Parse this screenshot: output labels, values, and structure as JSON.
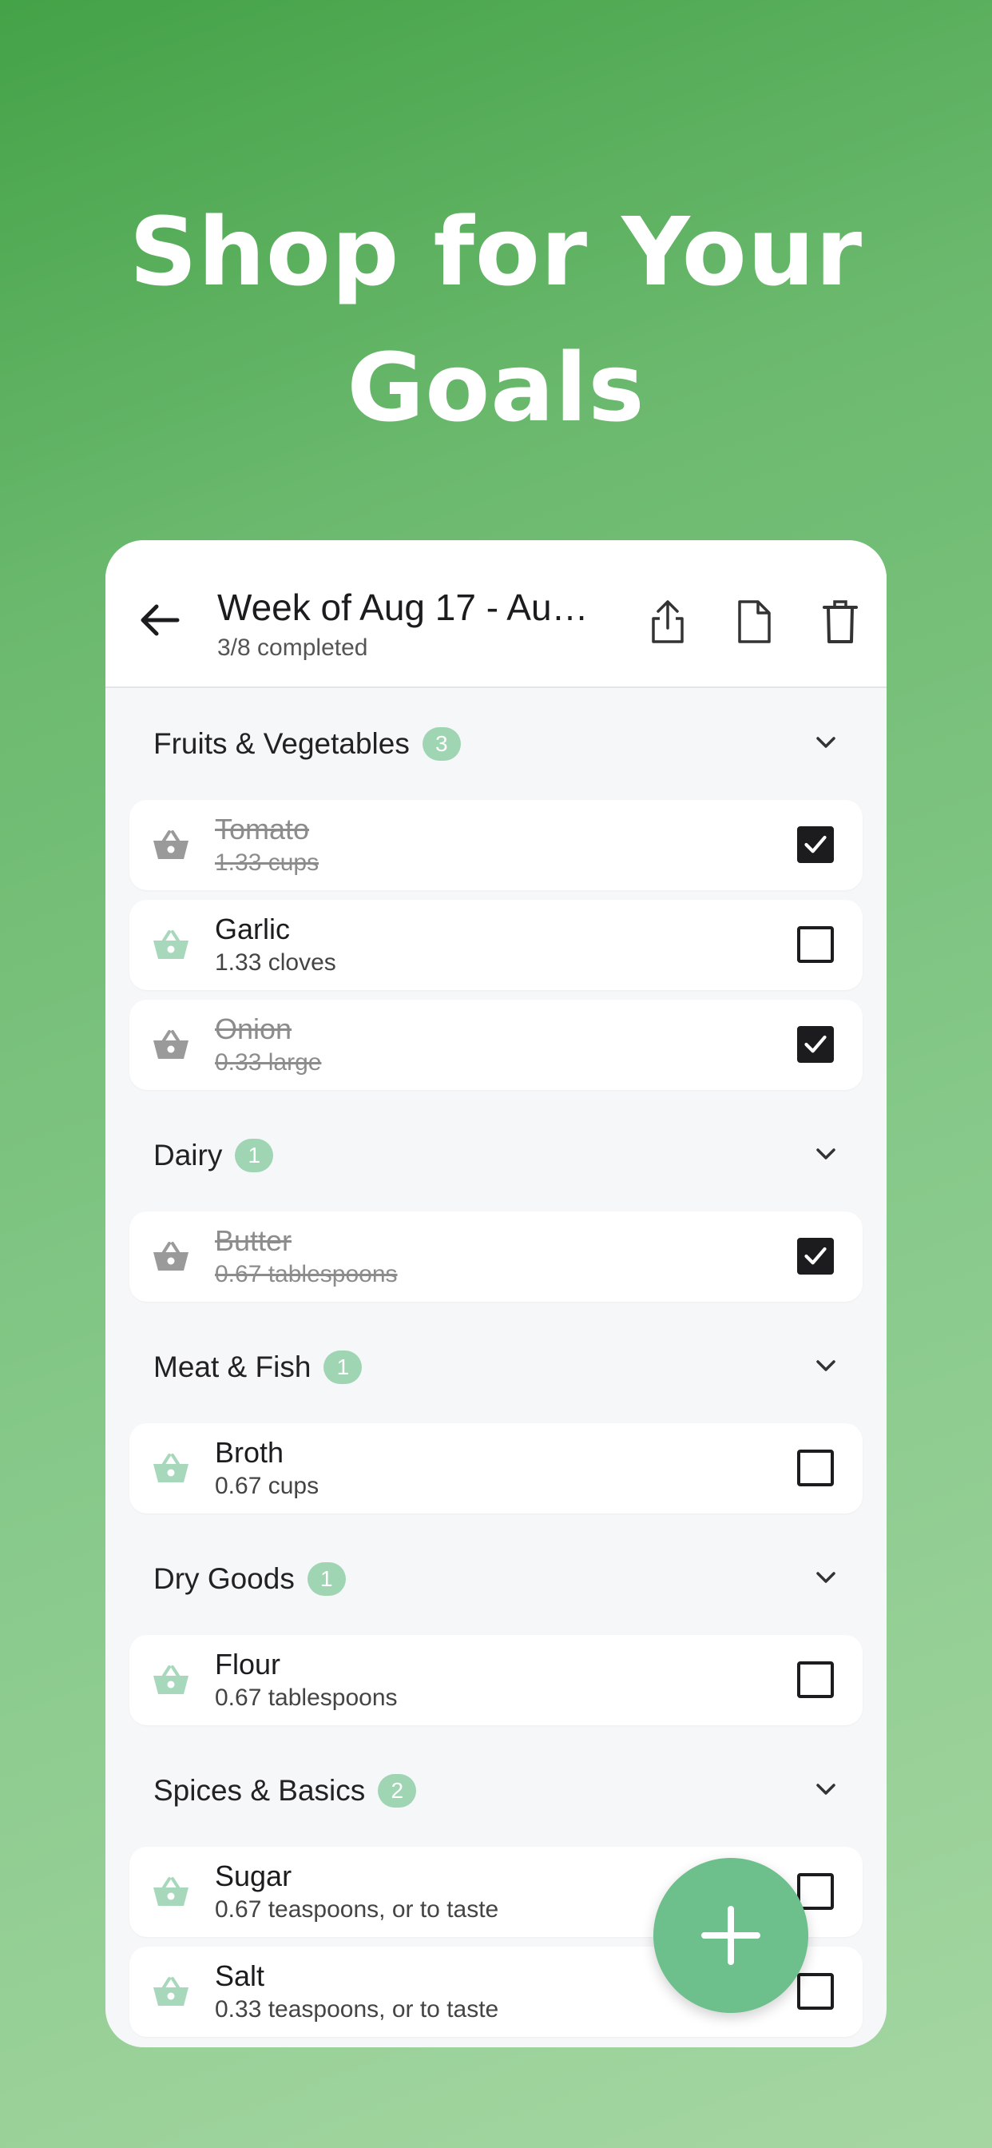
{
  "hero": {
    "line1": "Shop for Your",
    "line2": "Goals"
  },
  "appbar": {
    "title": "Week of Aug 17 - Aug…",
    "subtitle": "3/8 completed",
    "icons": [
      "back-arrow-icon",
      "share-icon",
      "document-icon",
      "trash-icon"
    ]
  },
  "colors": {
    "accent": "#6dbf8c",
    "badge": "#9fd5b2",
    "basket_active": "#a8d8bb",
    "basket_done": "#9a9a9a"
  },
  "sections": [
    {
      "title": "Fruits & Vegetables",
      "count": "3",
      "items": [
        {
          "name": "Tomato",
          "qty": "1.33 cups",
          "checked": true
        },
        {
          "name": "Garlic",
          "qty": "1.33 cloves",
          "checked": false
        },
        {
          "name": "Onion",
          "qty": "0.33 large",
          "checked": true
        }
      ]
    },
    {
      "title": "Dairy",
      "count": "1",
      "items": [
        {
          "name": "Butter",
          "qty": "0.67 tablespoons",
          "checked": true
        }
      ]
    },
    {
      "title": "Meat & Fish",
      "count": "1",
      "items": [
        {
          "name": "Broth",
          "qty": "0.67 cups",
          "checked": false
        }
      ]
    },
    {
      "title": "Dry Goods",
      "count": "1",
      "items": [
        {
          "name": "Flour",
          "qty": "0.67 tablespoons",
          "checked": false
        }
      ]
    },
    {
      "title": "Spices & Basics",
      "count": "2",
      "items": [
        {
          "name": "Sugar",
          "qty": "0.67 teaspoons, or to taste",
          "checked": false
        },
        {
          "name": "Salt",
          "qty": "0.33 teaspoons, or to taste",
          "checked": false
        }
      ]
    }
  ],
  "fab": {
    "icon": "plus-icon"
  }
}
